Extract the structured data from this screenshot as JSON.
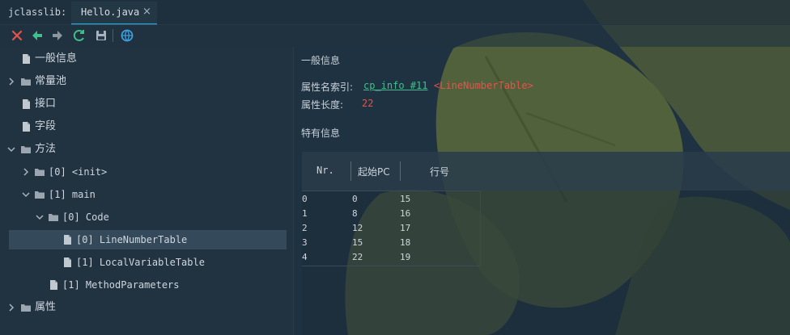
{
  "app": {
    "tool_label": "jclasslib:",
    "tab_title": "Hello.java"
  },
  "toolbar": {
    "buttons": [
      "close-icon",
      "back-icon",
      "forward-icon",
      "refresh-icon",
      "save-icon",
      "web-icon"
    ]
  },
  "tree": {
    "items": [
      {
        "label": "一般信息",
        "type": "file"
      },
      {
        "label": "常量池",
        "type": "folder",
        "expanded": false
      },
      {
        "label": "接口",
        "type": "file"
      },
      {
        "label": "字段",
        "type": "file"
      },
      {
        "label": "方法",
        "type": "folder",
        "expanded": true
      },
      {
        "label": "[0] <init>",
        "type": "folder",
        "expanded": false
      },
      {
        "label": "[1] main",
        "type": "folder",
        "expanded": true
      },
      {
        "label": "[0] Code",
        "type": "folder",
        "expanded": true
      },
      {
        "label": "[0] LineNumberTable",
        "type": "file",
        "selected": true
      },
      {
        "label": "[1] LocalVariableTable",
        "type": "file"
      },
      {
        "label": "[1] MethodParameters",
        "type": "file"
      },
      {
        "label": "属性",
        "type": "folder",
        "expanded": false
      }
    ]
  },
  "details": {
    "general_title": "一般信息",
    "attr_name_index_label": "属性名索引:",
    "attr_name_index_link": "cp_info #11",
    "attr_name_index_value": "<LineNumberTable>",
    "attr_length_label": "属性长度:",
    "attr_length_value": "22",
    "specific_title": "特有信息"
  },
  "table": {
    "headers": [
      "Nr.",
      "起始PC",
      "行号"
    ],
    "rows": [
      [
        "0",
        "0",
        "15"
      ],
      [
        "1",
        "8",
        "16"
      ],
      [
        "2",
        "12",
        "17"
      ],
      [
        "3",
        "15",
        "18"
      ],
      [
        "4",
        "22",
        "19"
      ]
    ]
  },
  "colors": {
    "accent": "#2f9fd1",
    "link": "#3ec08b",
    "value_red": "#e5544a",
    "selected_row": "#34495a"
  }
}
